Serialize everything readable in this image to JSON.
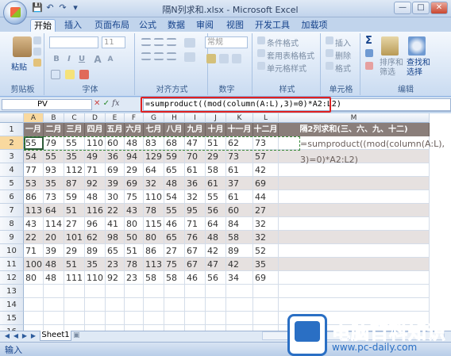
{
  "window": {
    "title": "隔N列求和.xlsx - Microsoft Excel",
    "min": "—",
    "max": "□",
    "close": "✕"
  },
  "qat": [
    "💾",
    "↶",
    "↷",
    "▾"
  ],
  "tabs": [
    "开始",
    "插入",
    "页面布局",
    "公式",
    "数据",
    "审阅",
    "视图",
    "开发工具",
    "加载项"
  ],
  "ribbon": {
    "clipboard": {
      "title": "剪贴板",
      "paste": "粘贴"
    },
    "font": {
      "title": "字体",
      "font_name": "",
      "font_size": "11",
      "b": "B",
      "i": "I",
      "u": "U",
      "a_big": "A",
      "a_small": "A"
    },
    "align": {
      "title": "对齐方式"
    },
    "number": {
      "title": "数字",
      "format": "常规"
    },
    "styles": {
      "title": "样式",
      "cond": "条件格式",
      "table": "套用表格格式",
      "cell": "单元格样式"
    },
    "cells": {
      "title": "单元格",
      "insert": "插入",
      "delete": "删除",
      "format": "格式"
    },
    "editing": {
      "title": "编辑",
      "sum": "Σ",
      "sort": "排序和筛选",
      "find": "查找和选择"
    }
  },
  "formula_bar": {
    "name_box": "PV",
    "fx": "fx",
    "formula": "=sumproduct((mod(column(A:L),3)=0)*A2:L2)"
  },
  "columns": [
    "A",
    "B",
    "C",
    "D",
    "E",
    "F",
    "G",
    "H",
    "I",
    "J",
    "K",
    "L",
    "M"
  ],
  "rows": [
    "1",
    "2",
    "3",
    "4",
    "5",
    "6",
    "7",
    "8",
    "9",
    "10",
    "11",
    "12",
    "13",
    "14",
    "15",
    "16"
  ],
  "header_row": [
    "一月",
    "二月",
    "三月",
    "四月",
    "五月",
    "六月",
    "七月",
    "八月",
    "九月",
    "十月",
    "十一月",
    "十二月",
    "隔2列求和(三、六、九、十二)"
  ],
  "data": [
    [
      55,
      79,
      55,
      110,
      60,
      48,
      83,
      68,
      47,
      51,
      62,
      73
    ],
    [
      54,
      55,
      35,
      49,
      36,
      94,
      129,
      59,
      70,
      29,
      73,
      57
    ],
    [
      77,
      93,
      112,
      71,
      69,
      29,
      64,
      65,
      61,
      58,
      61,
      42
    ],
    [
      53,
      35,
      87,
      92,
      39,
      69,
      32,
      48,
      36,
      61,
      37,
      69
    ],
    [
      86,
      73,
      59,
      48,
      30,
      75,
      110,
      54,
      32,
      55,
      61,
      44
    ],
    [
      113,
      64,
      51,
      116,
      22,
      43,
      78,
      55,
      95,
      56,
      60,
      27
    ],
    [
      43,
      114,
      27,
      96,
      41,
      80,
      115,
      46,
      71,
      64,
      84,
      32
    ],
    [
      22,
      20,
      101,
      62,
      98,
      50,
      80,
      65,
      76,
      48,
      58,
      32
    ],
    [
      71,
      39,
      29,
      89,
      65,
      51,
      86,
      27,
      67,
      42,
      89,
      52
    ],
    [
      100,
      48,
      51,
      35,
      23,
      78,
      113,
      75,
      67,
      47,
      42,
      35
    ],
    [
      80,
      48,
      111,
      110,
      92,
      23,
      58,
      58,
      46,
      56,
      34,
      69
    ]
  ],
  "m2_formula_line1": "=sumproduct((mod(column(A:L),",
  "m2_formula_line2": "3)=0)*A2:L2)",
  "sheet_tab": "Sheet1",
  "status": "输入",
  "watermark": {
    "name": "电脑百科知识",
    "url": "www.pc-daily.com"
  }
}
